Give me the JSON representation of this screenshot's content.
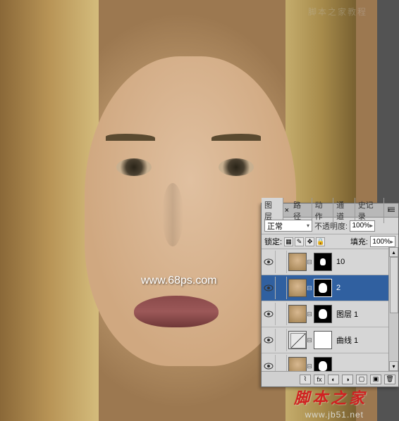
{
  "watermarks": {
    "url": "www.68ps.com",
    "red_text": "脚本之家",
    "domain": "www.jb51.net",
    "top_faint": "脚本之家教程"
  },
  "panel": {
    "tabs": {
      "layers": "图层",
      "paths": "路径",
      "actions": "动作",
      "channels": "通道",
      "history": "史记录",
      "close": "×"
    },
    "blend_mode": "正常",
    "opacity_label": "不透明度:",
    "opacity_value": "100%",
    "lock_label": "锁定:",
    "fill_label": "填充:",
    "fill_value": "100%",
    "layers": [
      {
        "name": "10",
        "has_mask": true,
        "type": "image"
      },
      {
        "name": "2",
        "has_mask": true,
        "type": "image",
        "selected": true
      },
      {
        "name": "图层 1",
        "has_mask": true,
        "type": "image"
      },
      {
        "name": "曲线 1",
        "has_mask": true,
        "type": "curves"
      },
      {
        "name": "",
        "has_mask": true,
        "type": "image"
      }
    ]
  }
}
